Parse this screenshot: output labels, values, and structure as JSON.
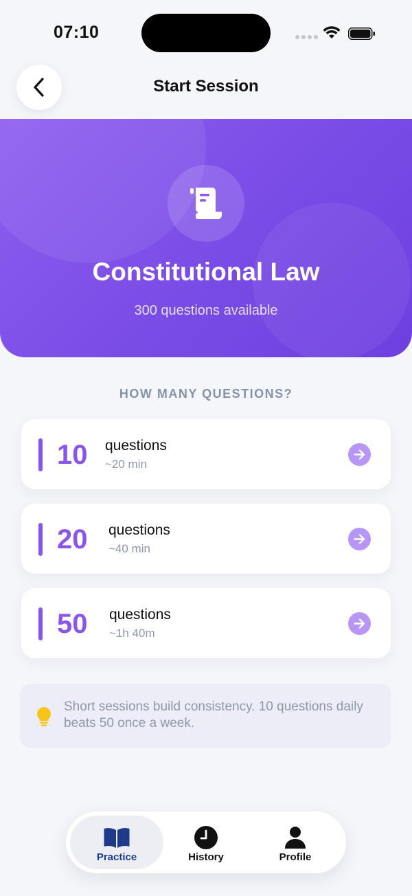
{
  "status_bar": {
    "time": "07:10",
    "icons": [
      "signal-icon",
      "wifi-icon",
      "battery-icon"
    ]
  },
  "header": {
    "title": "Start Session",
    "back_icon": "chevron-left-icon"
  },
  "hero": {
    "icon": "scroll-icon",
    "title": "Constitutional Law",
    "subtitle": "300 questions available"
  },
  "section_label": "HOW MANY QUESTIONS?",
  "options": [
    {
      "count": "10",
      "label": "questions",
      "duration": "~20 min"
    },
    {
      "count": "20",
      "label": "questions",
      "duration": "~40 min"
    },
    {
      "count": "50",
      "label": "questions",
      "duration": "~1h 40m"
    }
  ],
  "tip": {
    "icon": "lightbulb-icon",
    "text": "Short sessions build consistency. 10 questions daily beats 50 once a week."
  },
  "tab_bar": {
    "tabs": [
      {
        "label": "Practice",
        "icon": "book-icon",
        "active": true
      },
      {
        "label": "History",
        "icon": "clock-icon",
        "active": false
      },
      {
        "label": "Profile",
        "icon": "person-icon",
        "active": false
      }
    ]
  },
  "colors": {
    "accent": "#8a55ea",
    "hero_start": "#8f5ef0",
    "hero_end": "#6e3fe0",
    "active_tab_text": "#1e3a8a",
    "tip_bulb": "#f5c518"
  }
}
